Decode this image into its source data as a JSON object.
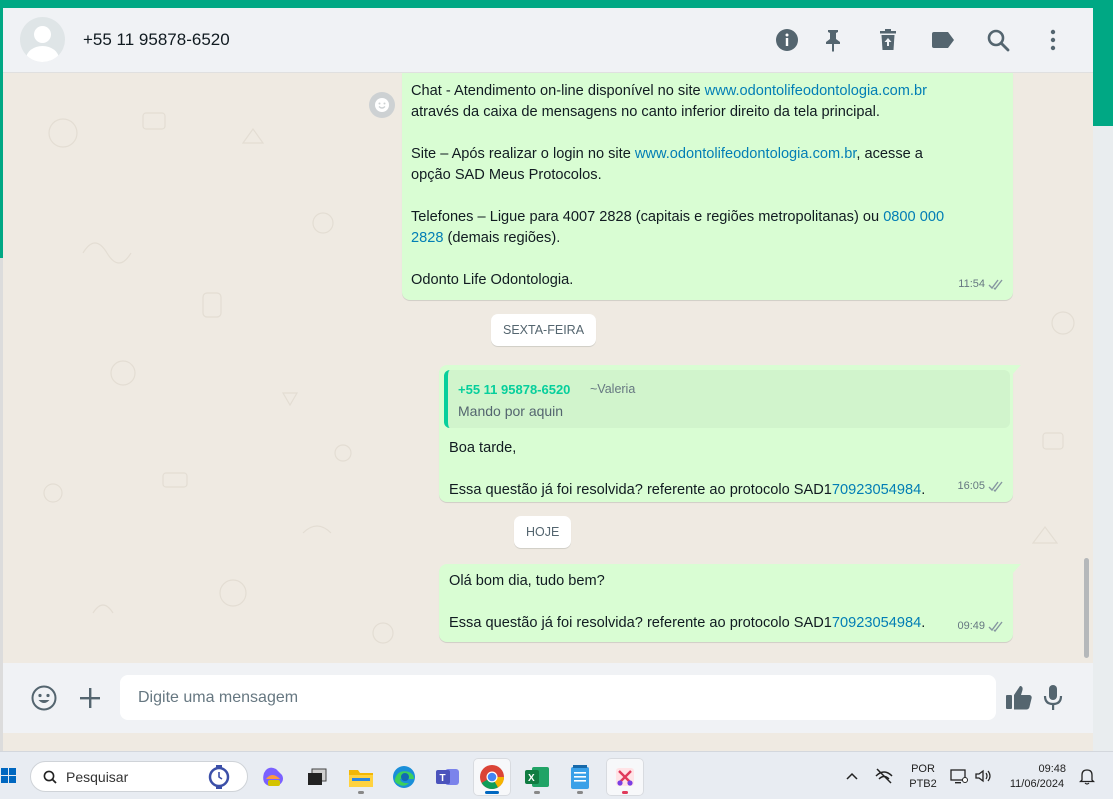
{
  "header": {
    "contact_name": "+55 11 95878-6520"
  },
  "messages": {
    "m1": {
      "line1_text": "Chat - Atendimento on-line disponível no site ",
      "line1_link": "www.odontolifeodontologia.com.br",
      "line2_text": "através da caixa de mensagens no canto inferior direito da tela principal.",
      "line3_text": "Site – Após realizar o login no site ",
      "line3_link": "www.odontolifeodontologia.com.br",
      "line3_text_after": ", acesse a",
      "line4_text": "opção SAD Meus Protocolos.",
      "line5_text": "Telefones – Ligue para 4007 2828 (capitais e regiões metropolitanas) ou ",
      "line5_link": "0800 000",
      "line6_link": "2828",
      "line6_text": " (demais regiões).",
      "line7_text": "Odonto Life Odontologia.",
      "time": "11:54"
    },
    "day1": "SEXTA-FEIRA",
    "m2": {
      "quote_name": "+55 11 95878-6520",
      "quote_alias": "~Valeria",
      "quote_text": "Mando por aquin",
      "line1": "Boa tarde,",
      "line2_text": "Essa questão já foi resolvida? referente ao protocolo SAD1",
      "line2_link": "70923054984",
      "line2_after": ".",
      "time": "16:05"
    },
    "day2": "HOJE",
    "m3": {
      "line1": "Olá bom dia, tudo bem?",
      "line2_text": "Essa questão já foi resolvida? referente ao protocolo SAD1",
      "line2_link": "70923054984",
      "line2_after": ".",
      "time": "09:49"
    }
  },
  "composer": {
    "placeholder": "Digite uma mensagem"
  },
  "taskbar": {
    "search_label": "Pesquisar",
    "lang_top": "POR",
    "lang_bottom": "PTB2",
    "time": "09:48",
    "date": "11/06/2024"
  },
  "colors": {
    "accent": "#00a884",
    "outgoing_bubble": "#d9fdd3",
    "link": "#027eb5",
    "quote_name": "#06cf9c"
  }
}
